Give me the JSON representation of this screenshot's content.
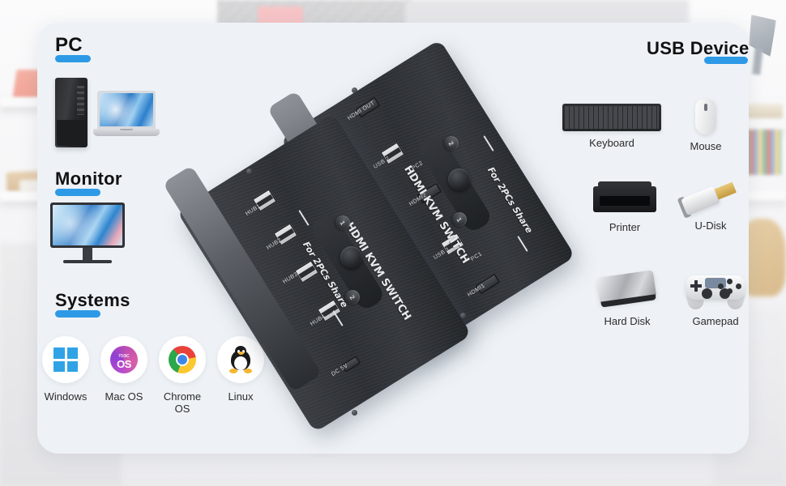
{
  "sections": {
    "pc": {
      "heading": "PC"
    },
    "monitor": {
      "heading": "Monitor"
    },
    "systems": {
      "heading": "Systems"
    },
    "usb": {
      "heading": "USB Device"
    }
  },
  "systems": [
    {
      "label": "Windows",
      "icon": "windows-logo-icon"
    },
    {
      "label": "Mac OS",
      "icon": "macos-logo-icon",
      "mark_small": "mac",
      "mark_big": "OS"
    },
    {
      "label": "Chrome OS",
      "icon": "chrome-logo-icon"
    },
    {
      "label": "Linux",
      "icon": "linux-tux-icon"
    }
  ],
  "usb_devices": [
    {
      "label": "Keyboard",
      "icon": "keyboard-icon"
    },
    {
      "label": "Mouse",
      "icon": "mouse-icon"
    },
    {
      "label": "Printer",
      "icon": "printer-icon"
    },
    {
      "label": "U-Disk",
      "icon": "usb-flash-drive-icon"
    },
    {
      "label": "Hard Disk",
      "icon": "external-hard-disk-icon"
    },
    {
      "label": "Gamepad",
      "icon": "gamepad-icon"
    }
  ],
  "pc_devices": [
    {
      "icon": "desktop-tower-icon"
    },
    {
      "icon": "laptop-icon"
    }
  ],
  "monitor_device": {
    "icon": "monitor-icon"
  },
  "kvm_front": {
    "brand": "HDMI KVM SWITCH",
    "tagline": "For 2PCs Share",
    "ports": [
      "HUB1",
      "HUB2",
      "HUB3",
      "HUB4"
    ],
    "power_label": "DC 5V",
    "buttons": [
      "1",
      "2"
    ]
  },
  "kvm_rear": {
    "brand": "HDMI KVM SWITCH",
    "tagline": "For 2PCs Share",
    "output_label": "HDMI OUT",
    "pc2": {
      "usb": "USB 2",
      "group": "PC2",
      "hdmi": "HDMI2"
    },
    "pc1": {
      "usb": "USB 1",
      "group": "PC1",
      "hdmi": "HDMI1"
    },
    "buttons": [
      "1",
      "2"
    ]
  },
  "colors": {
    "accent_blue": "#2e9ae6",
    "card_bg": "#eef2f6",
    "heading_text": "#111111",
    "label_text": "#2b2b2b"
  }
}
